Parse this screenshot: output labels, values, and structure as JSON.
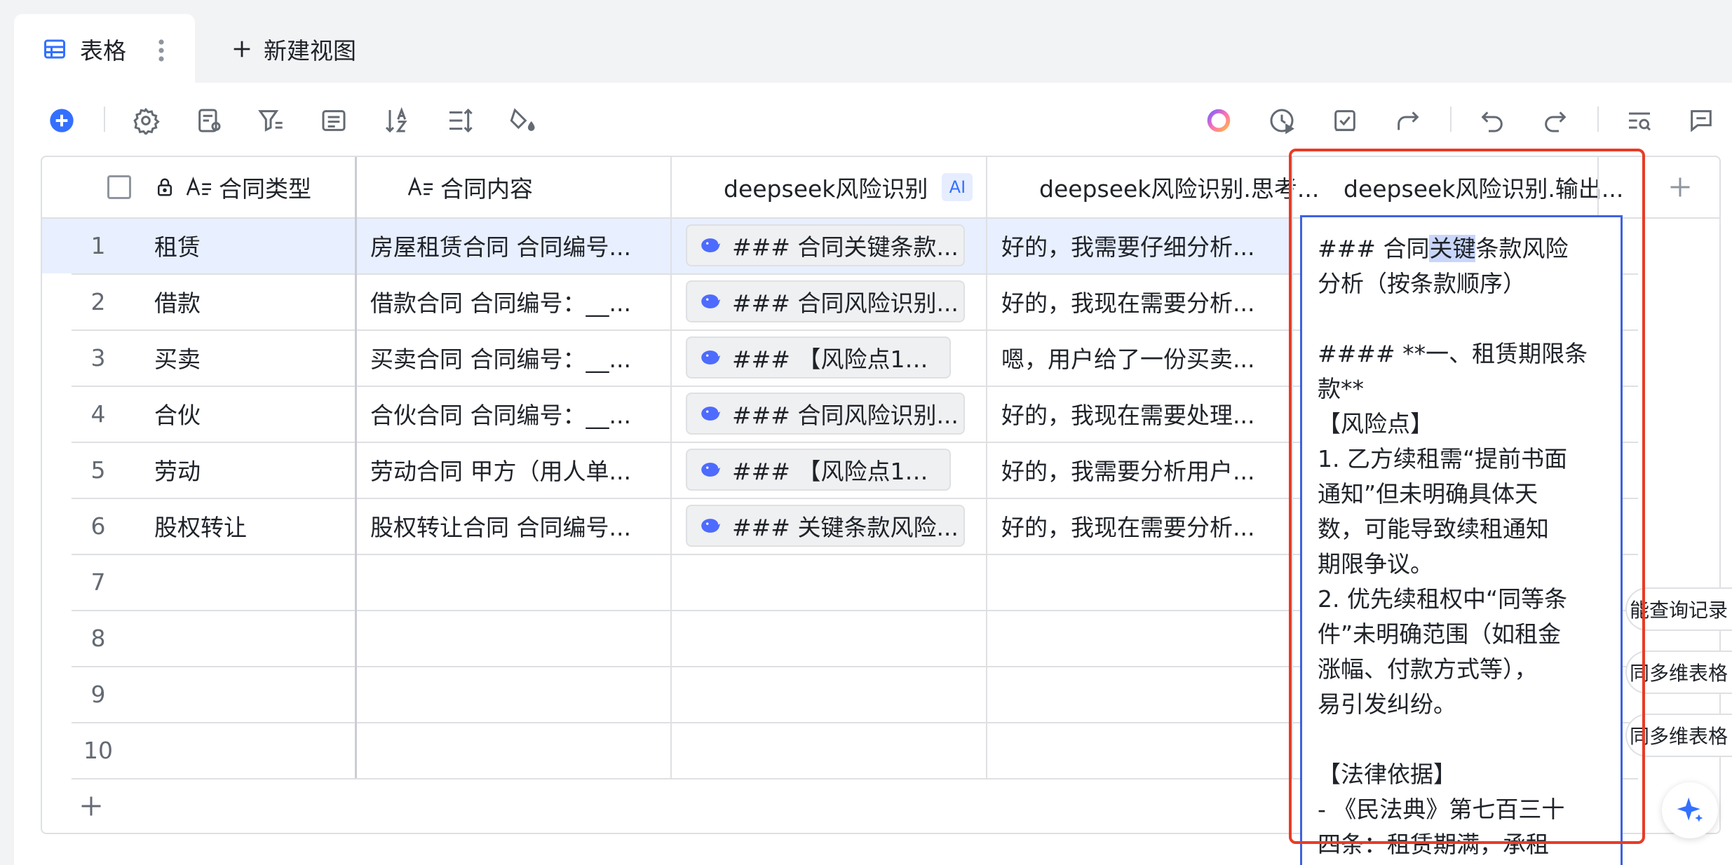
{
  "tabs": {
    "active_label": "表格",
    "new_view_label": "新建视图"
  },
  "toolbar": {
    "left_icons": [
      "add-icon",
      "settings-icon",
      "field-settings-icon",
      "filter-icon",
      "list-icon",
      "sort-az-icon",
      "row-height-icon",
      "paint-bucket-icon"
    ],
    "right_icons": [
      "ai-ring-icon",
      "history-icon",
      "task-check-icon",
      "share-icon",
      "undo-icon",
      "redo-icon",
      "search-list-icon",
      "comment-icon"
    ]
  },
  "table": {
    "columns": [
      {
        "label": "合同类型"
      },
      {
        "label": "合同内容"
      },
      {
        "label": "deepseek风险识别",
        "badge": "AI"
      },
      {
        "label": "deepseek风险识别.思考..."
      },
      {
        "label": "deepseek风险识别.输出..."
      }
    ],
    "rows": [
      {
        "num": "1",
        "type": "租赁",
        "content": "房屋租赁合同 合同编号...",
        "risk": "### 合同关键条款...",
        "think": "好的，我需要仔细分析..."
      },
      {
        "num": "2",
        "type": "借款",
        "content": "借款合同 合同编号：__...",
        "risk": "### 合同风险识别...",
        "think": "好的，我现在需要分析..."
      },
      {
        "num": "3",
        "type": "买卖",
        "content": "买卖合同 合同编号：__...",
        "risk": "### 【风险点1：...",
        "think": "嗯，用户给了一份买卖..."
      },
      {
        "num": "4",
        "type": "合伙",
        "content": "合伙合同 合同编号：__...",
        "risk": "### 合同风险识别...",
        "think": "好的，我现在需要处理..."
      },
      {
        "num": "5",
        "type": "劳动",
        "content": "劳动合同 甲方（用人单...",
        "risk": "### 【风险点1】...",
        "think": "好的，我需要分析用户..."
      },
      {
        "num": "6",
        "type": "股权转让",
        "content": "股权转让合同 合同编号...",
        "risk": "### 关键条款风险...",
        "think": "好的，我现在需要分析..."
      },
      {
        "num": "7"
      },
      {
        "num": "8"
      },
      {
        "num": "9"
      },
      {
        "num": "10"
      }
    ]
  },
  "expanded_cell": {
    "part1": "### 合同",
    "highlight": "关键",
    "part2": "条款风险\n分析（按条款顺序）\n\n#### **一、租赁期限条\n款**\n【风险点】\n1. 乙方续租需“提前书面\n通知”但未明确具体天\n数，可能导致续租通知\n期限争议。\n2. 优先续租权中“同等条\n件”未明确范围（如租金\n涨幅、付款方式等），\n易引发纠纷。\n\n【法律依据】\n- 《民法典》第七百三十\n四条：租赁期满，承租"
  },
  "side_panel": {
    "items": [
      "能查询记录",
      "同多维表格",
      "同多维表格"
    ]
  },
  "colors": {
    "accent": "#3370ff",
    "selected_row": "#e8efff",
    "red_frame": "#e83c26",
    "blue_frame": "#3e62e0"
  }
}
